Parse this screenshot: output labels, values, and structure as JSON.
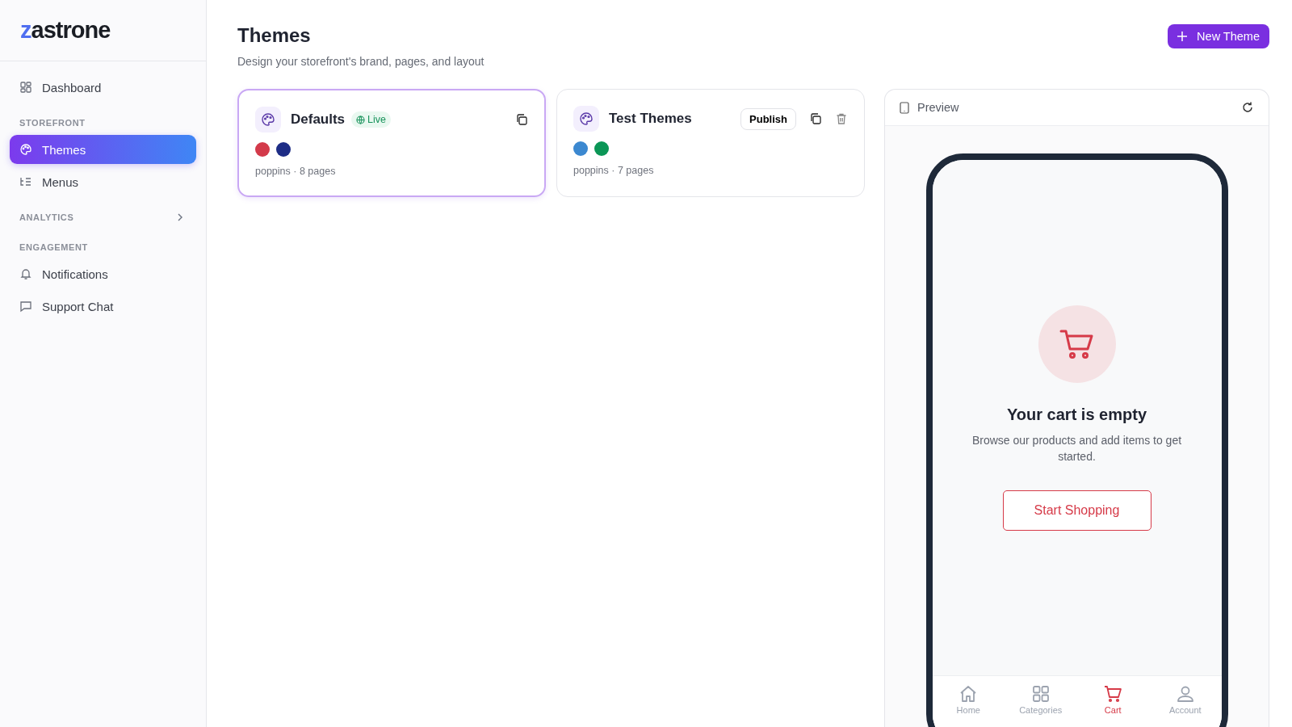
{
  "logo": {
    "accent": "z",
    "rest": "astrone"
  },
  "sidebar": {
    "items": [
      {
        "kind": "link",
        "label": "Dashboard",
        "selected": false
      },
      {
        "kind": "section",
        "label": "STOREFRONT"
      },
      {
        "kind": "link",
        "label": "Themes",
        "selected": true
      },
      {
        "kind": "link",
        "label": "Menus",
        "selected": false
      },
      {
        "kind": "section",
        "label": "ANALYTICS",
        "expanded": false
      },
      {
        "kind": "section",
        "label": "ENGAGEMENT"
      },
      {
        "kind": "link",
        "label": "Notifications",
        "selected": false
      },
      {
        "kind": "link",
        "label": "Support Chat",
        "selected": false
      }
    ]
  },
  "header": {
    "title": "Themes",
    "subtitle": "Design your storefront's brand, pages, and layout",
    "button": "New Theme"
  },
  "themes": [
    {
      "name": "Defaults",
      "selected": true,
      "live": true,
      "live_label": "Live",
      "colors": [
        {
          "color": "#d33a4a"
        },
        {
          "color": "#1e2d86"
        }
      ],
      "meta": "poppins · 8 pages"
    },
    {
      "name": "Test Themes",
      "selected": false,
      "live": false,
      "publish_label": "Publish",
      "colors": [
        {
          "color": "#3b88d0"
        },
        {
          "color": "#0b9656"
        }
      ],
      "meta": "poppins · 7 pages"
    }
  ],
  "preview": {
    "title": "Preview",
    "empty_title": "Your cart is empty",
    "empty_text": "Browse our products and add items to get started.",
    "cta": "Start Shopping",
    "nav": [
      {
        "label": "Home",
        "selected": false
      },
      {
        "label": "Categories",
        "selected": false
      },
      {
        "label": "Cart",
        "selected": true
      },
      {
        "label": "Account",
        "selected": false
      }
    ]
  }
}
